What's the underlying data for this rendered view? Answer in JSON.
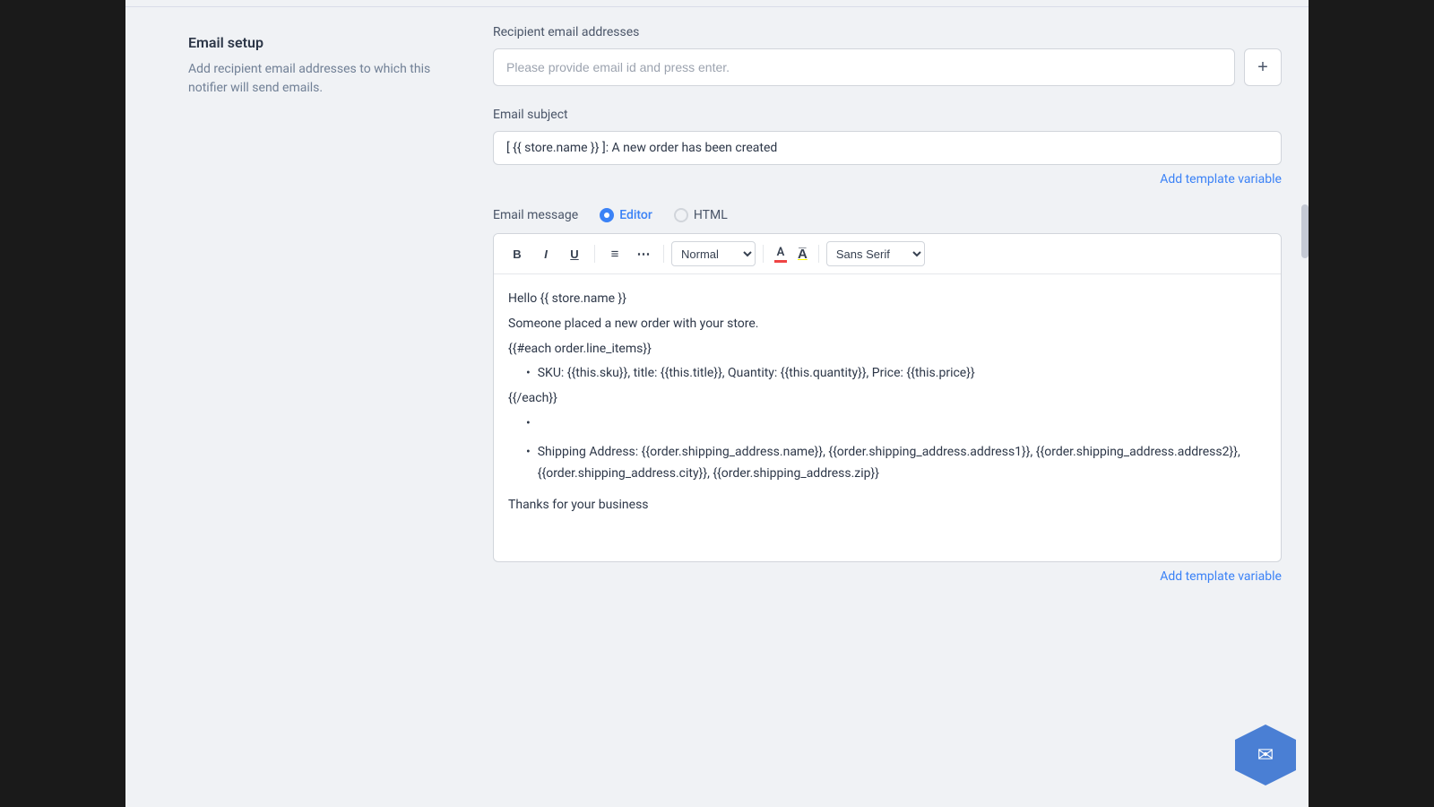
{
  "page": {
    "background": "#1a1a1a"
  },
  "left_panel": {
    "title": "Email setup",
    "description": "Add recipient email addresses to which this notifier will send emails."
  },
  "email_section": {
    "recipient_label": "Recipient email addresses",
    "email_input_placeholder": "Please provide email id and press enter.",
    "add_button_label": "+",
    "subject_label": "Email subject",
    "subject_value": "[ {{ store.name }} ]: A new order has been created",
    "add_template_variable_label": "Add template variable",
    "message_label": "Email message",
    "editor_radio_label": "Editor",
    "html_radio_label": "HTML",
    "toolbar": {
      "bold": "B",
      "italic": "I",
      "underline": "U",
      "ordered_list": "≡",
      "unordered_list": "☰",
      "format_select": "Normal",
      "font_color_letter": "A",
      "font_size_icon": "A",
      "font_family": "Sans Serif"
    },
    "editor_content": {
      "line1": "Hello {{ store.name }}",
      "line2": "",
      "line3": "Someone placed a new order with your store.",
      "line4": "",
      "line5": "{{#each order.line_items}}",
      "line6_bullet": "SKU: {{this.sku}}, title: {{this.title}}, Quantity: {{this.quantity}}, Price: {{this.price}}",
      "line7": "{{/each}}",
      "line8": "",
      "line9_bullet": "Shipping Address: {{order.shipping_address.name}}, {{order.shipping_address.address1}}, {{order.shipping_address.address2}}, {{order.shipping_address.city}}, {{order.shipping_address.zip}}",
      "line10": "",
      "line11": "Thanks for your business"
    },
    "bottom_add_template_label": "Add template variable"
  }
}
